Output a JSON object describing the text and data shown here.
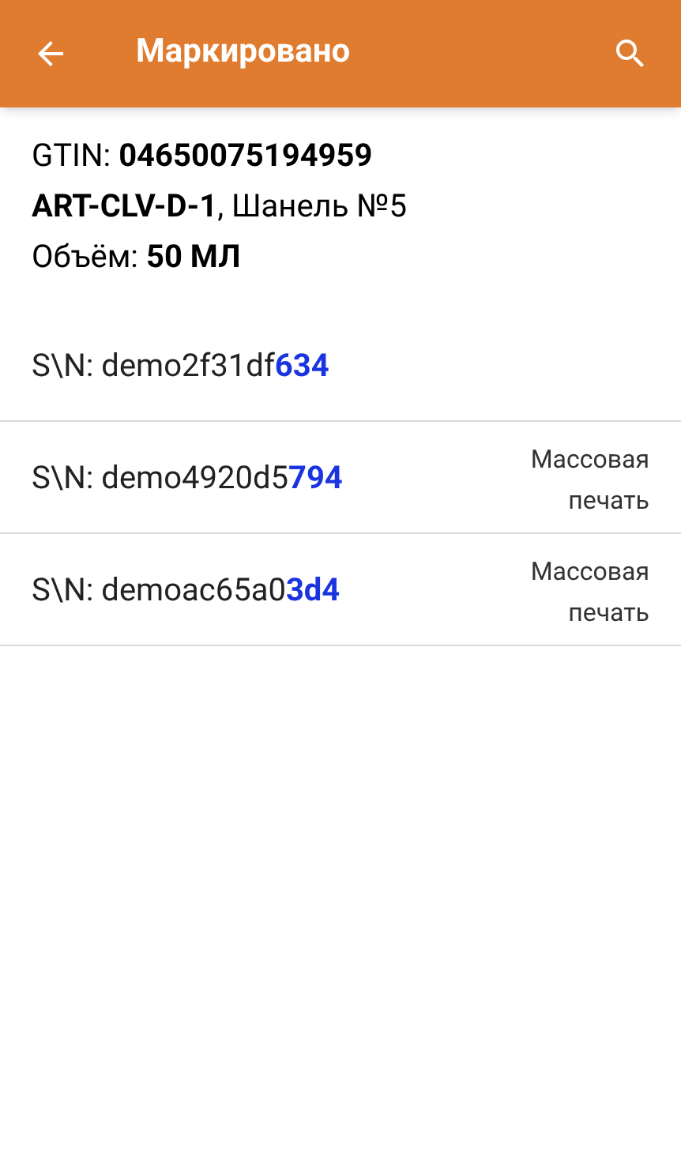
{
  "header": {
    "title": "Маркировано"
  },
  "info": [
    "GTIN: **04650075194959**",
    "**ART-CLV-D-1**, Шанель №5",
    "Объём: **50 МЛ**"
  ],
  "serials": [
    {
      "prefix": "S\\N: demo2f31df",
      "highlight": "634"
    },
    {
      "prefix": "S\\N: demo4920d5",
      "highlight": "794",
      "note": "Массовая печать"
    },
    {
      "prefix": "S\\N: demoac65a0",
      "highlight": "3d4",
      "note": "Массовая печать"
    }
  ]
}
